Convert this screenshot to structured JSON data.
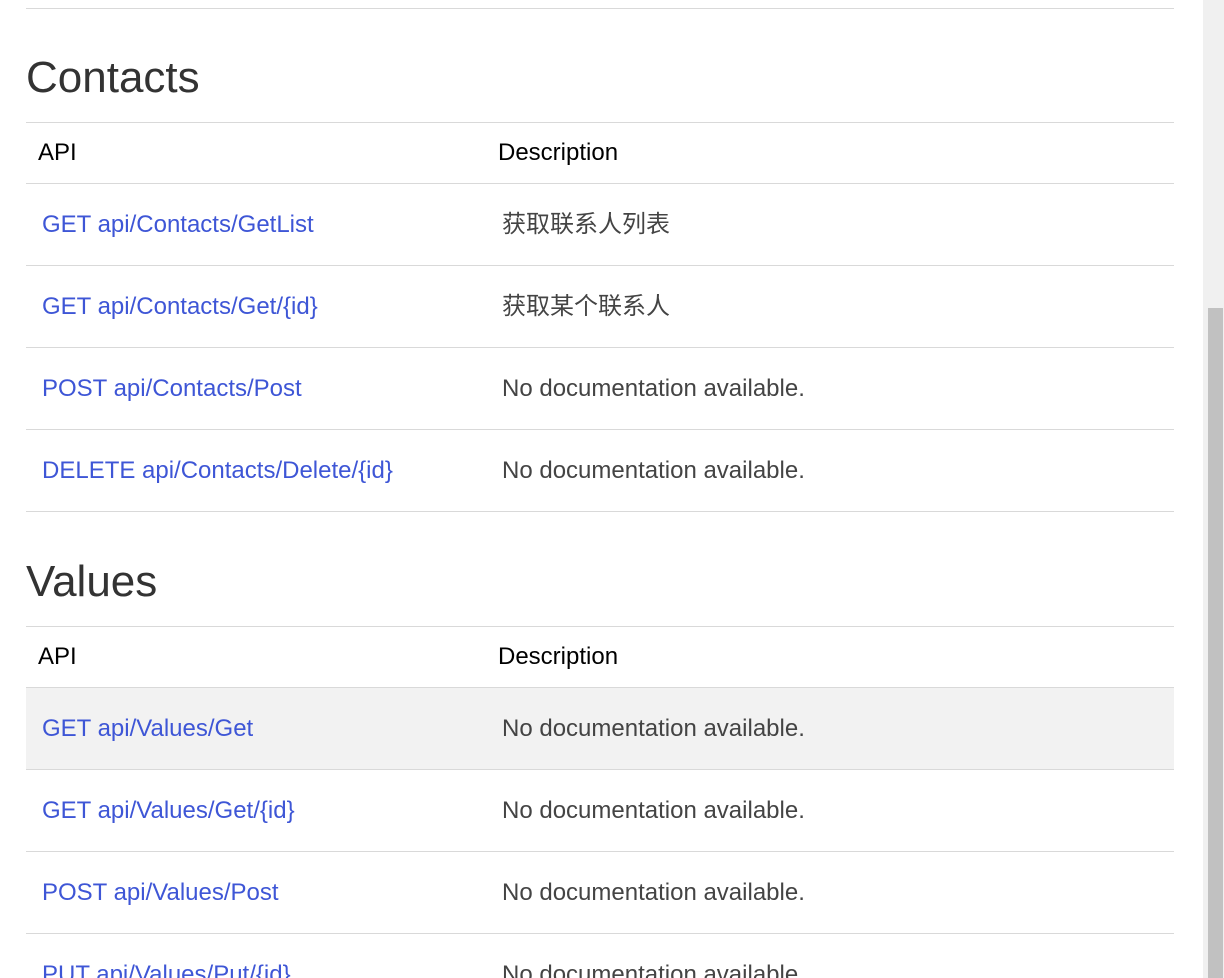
{
  "sections": [
    {
      "title": "Contacts",
      "headers": {
        "api": "API",
        "description": "Description"
      },
      "rows": [
        {
          "api": "GET api/Contacts/GetList",
          "description": "获取联系人列表"
        },
        {
          "api": "GET api/Contacts/Get/{id}",
          "description": "获取某个联系人"
        },
        {
          "api": "POST api/Contacts/Post",
          "description": "No documentation available."
        },
        {
          "api": "DELETE api/Contacts/Delete/{id}",
          "description": "No documentation available."
        }
      ]
    },
    {
      "title": "Values",
      "headers": {
        "api": "API",
        "description": "Description"
      },
      "rows": [
        {
          "api": "GET api/Values/Get",
          "description": "No documentation available.",
          "hovered": true
        },
        {
          "api": "GET api/Values/Get/{id}",
          "description": "No documentation available."
        },
        {
          "api": "POST api/Values/Post",
          "description": "No documentation available."
        },
        {
          "api": "PUT api/Values/Put/{id}",
          "description": "No documentation available."
        }
      ]
    }
  ],
  "colors": {
    "link": "#3e56d6",
    "rule": "#d9d9d9",
    "row_highlight": "#f2f2f2",
    "scrollbar_thumb": "#c1c1c1"
  }
}
